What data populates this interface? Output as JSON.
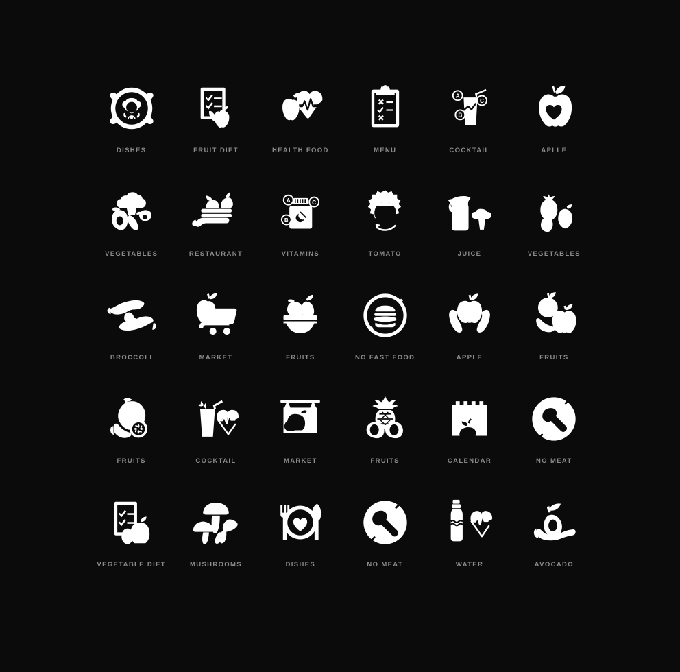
{
  "page": {
    "background_color": "#0b0b0b",
    "icon_color": "#ffffff",
    "label_color": "#8b8b8b",
    "columns": 6,
    "rows": 5
  },
  "icons": [
    {
      "label": "DISHES",
      "glyph": "cooking-pot-icon"
    },
    {
      "label": "FRUIT DIET",
      "glyph": "clipboard-banana-apple-icon"
    },
    {
      "label": "HEALTH FOOD",
      "glyph": "apple-heartbeat-icon"
    },
    {
      "label": "MENU",
      "glyph": "clipboard-checklist-icon"
    },
    {
      "label": "COCKTAIL",
      "glyph": "vitamin-drink-glass-icon"
    },
    {
      "label": "APLLE",
      "glyph": "apple-heart-icon"
    },
    {
      "label": "VEGETABLES",
      "glyph": "broccoli-avocado-carrot-icon"
    },
    {
      "label": "RESTAURANT",
      "glyph": "hand-serving-tray-fruit-icon"
    },
    {
      "label": "VITAMINS",
      "glyph": "vitamin-bottle-icon"
    },
    {
      "label": "TOMATO",
      "glyph": "tomato-refresh-icon"
    },
    {
      "label": "JUICE",
      "glyph": "juice-pitcher-broccoli-icon"
    },
    {
      "label": "VEGETABLES",
      "glyph": "tomato-pepper-onion-icon"
    },
    {
      "label": "BROCCOLI",
      "glyph": "hands-holding-broccoli-icon"
    },
    {
      "label": "MARKET",
      "glyph": "shopping-cart-apple-icon"
    },
    {
      "label": "FRUITS",
      "glyph": "fruit-bowl-icon"
    },
    {
      "label": "NO FAST FOOD",
      "glyph": "no-burger-icon"
    },
    {
      "label": "APPLE",
      "glyph": "hands-holding-apple-icon"
    },
    {
      "label": "FRUITS",
      "glyph": "orange-banana-apple-icon"
    },
    {
      "label": "FRUITS",
      "glyph": "mango-banana-citrus-icon"
    },
    {
      "label": "COCKTAIL",
      "glyph": "cocktail-heartbeat-icon"
    },
    {
      "label": "MARKET",
      "glyph": "market-sign-produce-icon"
    },
    {
      "label": "FRUITS",
      "glyph": "pineapple-avocado-icon"
    },
    {
      "label": "CALENDAR",
      "glyph": "calendar-love-apple-icon"
    },
    {
      "label": "NO MEAT",
      "glyph": "no-chicken-leg-icon"
    },
    {
      "label": "VEGETABLE DIET",
      "glyph": "clipboard-pepper-apple-icon"
    },
    {
      "label": "MUSHROOMS",
      "glyph": "mushrooms-icon"
    },
    {
      "label": "DISHES",
      "glyph": "plate-fork-knife-heart-icon"
    },
    {
      "label": "NO MEAT",
      "glyph": "no-chicken-leg-2-icon"
    },
    {
      "label": "WATER",
      "glyph": "water-bottle-heartbeat-icon"
    },
    {
      "label": "AVOCADO",
      "glyph": "hand-holding-avocado-icon"
    }
  ]
}
